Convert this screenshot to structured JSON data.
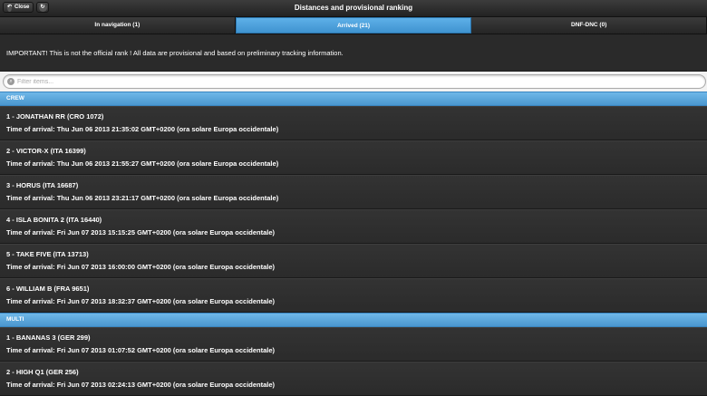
{
  "header": {
    "title": "Distances and provisional ranking",
    "close_label": "Close"
  },
  "tabs": [
    {
      "label": "In navigation (1)"
    },
    {
      "label": "Arrived (21)"
    },
    {
      "label": "DNF-DNC (0)"
    }
  ],
  "notice": "IMPORTANT! This is not the official rank ! All data are provisional and based on preliminary tracking information.",
  "filter": {
    "placeholder": "Filter items..."
  },
  "groups": [
    {
      "label": "CREW",
      "items": [
        {
          "name": "1 - JONATHAN RR (CRO 1072)",
          "arrival": "Time of arrival: Thu Jun 06 2013 21:35:02 GMT+0200 (ora solare Europa occidentale)"
        },
        {
          "name": "2 - VICTOR-X (ITA 16399)",
          "arrival": "Time of arrival: Thu Jun 06 2013 21:55:27 GMT+0200 (ora solare Europa occidentale)"
        },
        {
          "name": "3 - HORUS (ITA 16687)",
          "arrival": "Time of arrival: Thu Jun 06 2013 23:21:17 GMT+0200 (ora solare Europa occidentale)"
        },
        {
          "name": "4 - ISLA BONITA 2 (ITA 16440)",
          "arrival": "Time of arrival: Fri Jun 07 2013 15:15:25 GMT+0200 (ora solare Europa occidentale)"
        },
        {
          "name": "5 - TAKE FIVE (ITA 13713)",
          "arrival": "Time of arrival: Fri Jun 07 2013 16:00:00 GMT+0200 (ora solare Europa occidentale)"
        },
        {
          "name": "6 - WILLIAM B (FRA 9651)",
          "arrival": "Time of arrival: Fri Jun 07 2013 18:32:37 GMT+0200 (ora solare Europa occidentale)"
        }
      ]
    },
    {
      "label": "MULTI",
      "items": [
        {
          "name": "1 - BANANAS 3 (GER 299)",
          "arrival": "Time of arrival: Fri Jun 07 2013 01:07:52 GMT+0200 (ora solare Europa occidentale)"
        },
        {
          "name": "2 - HIGH Q1 (GER 256)",
          "arrival": "Time of arrival: Fri Jun 07 2013 02:24:13 GMT+0200 (ora solare Europa occidentale)"
        }
      ]
    }
  ]
}
